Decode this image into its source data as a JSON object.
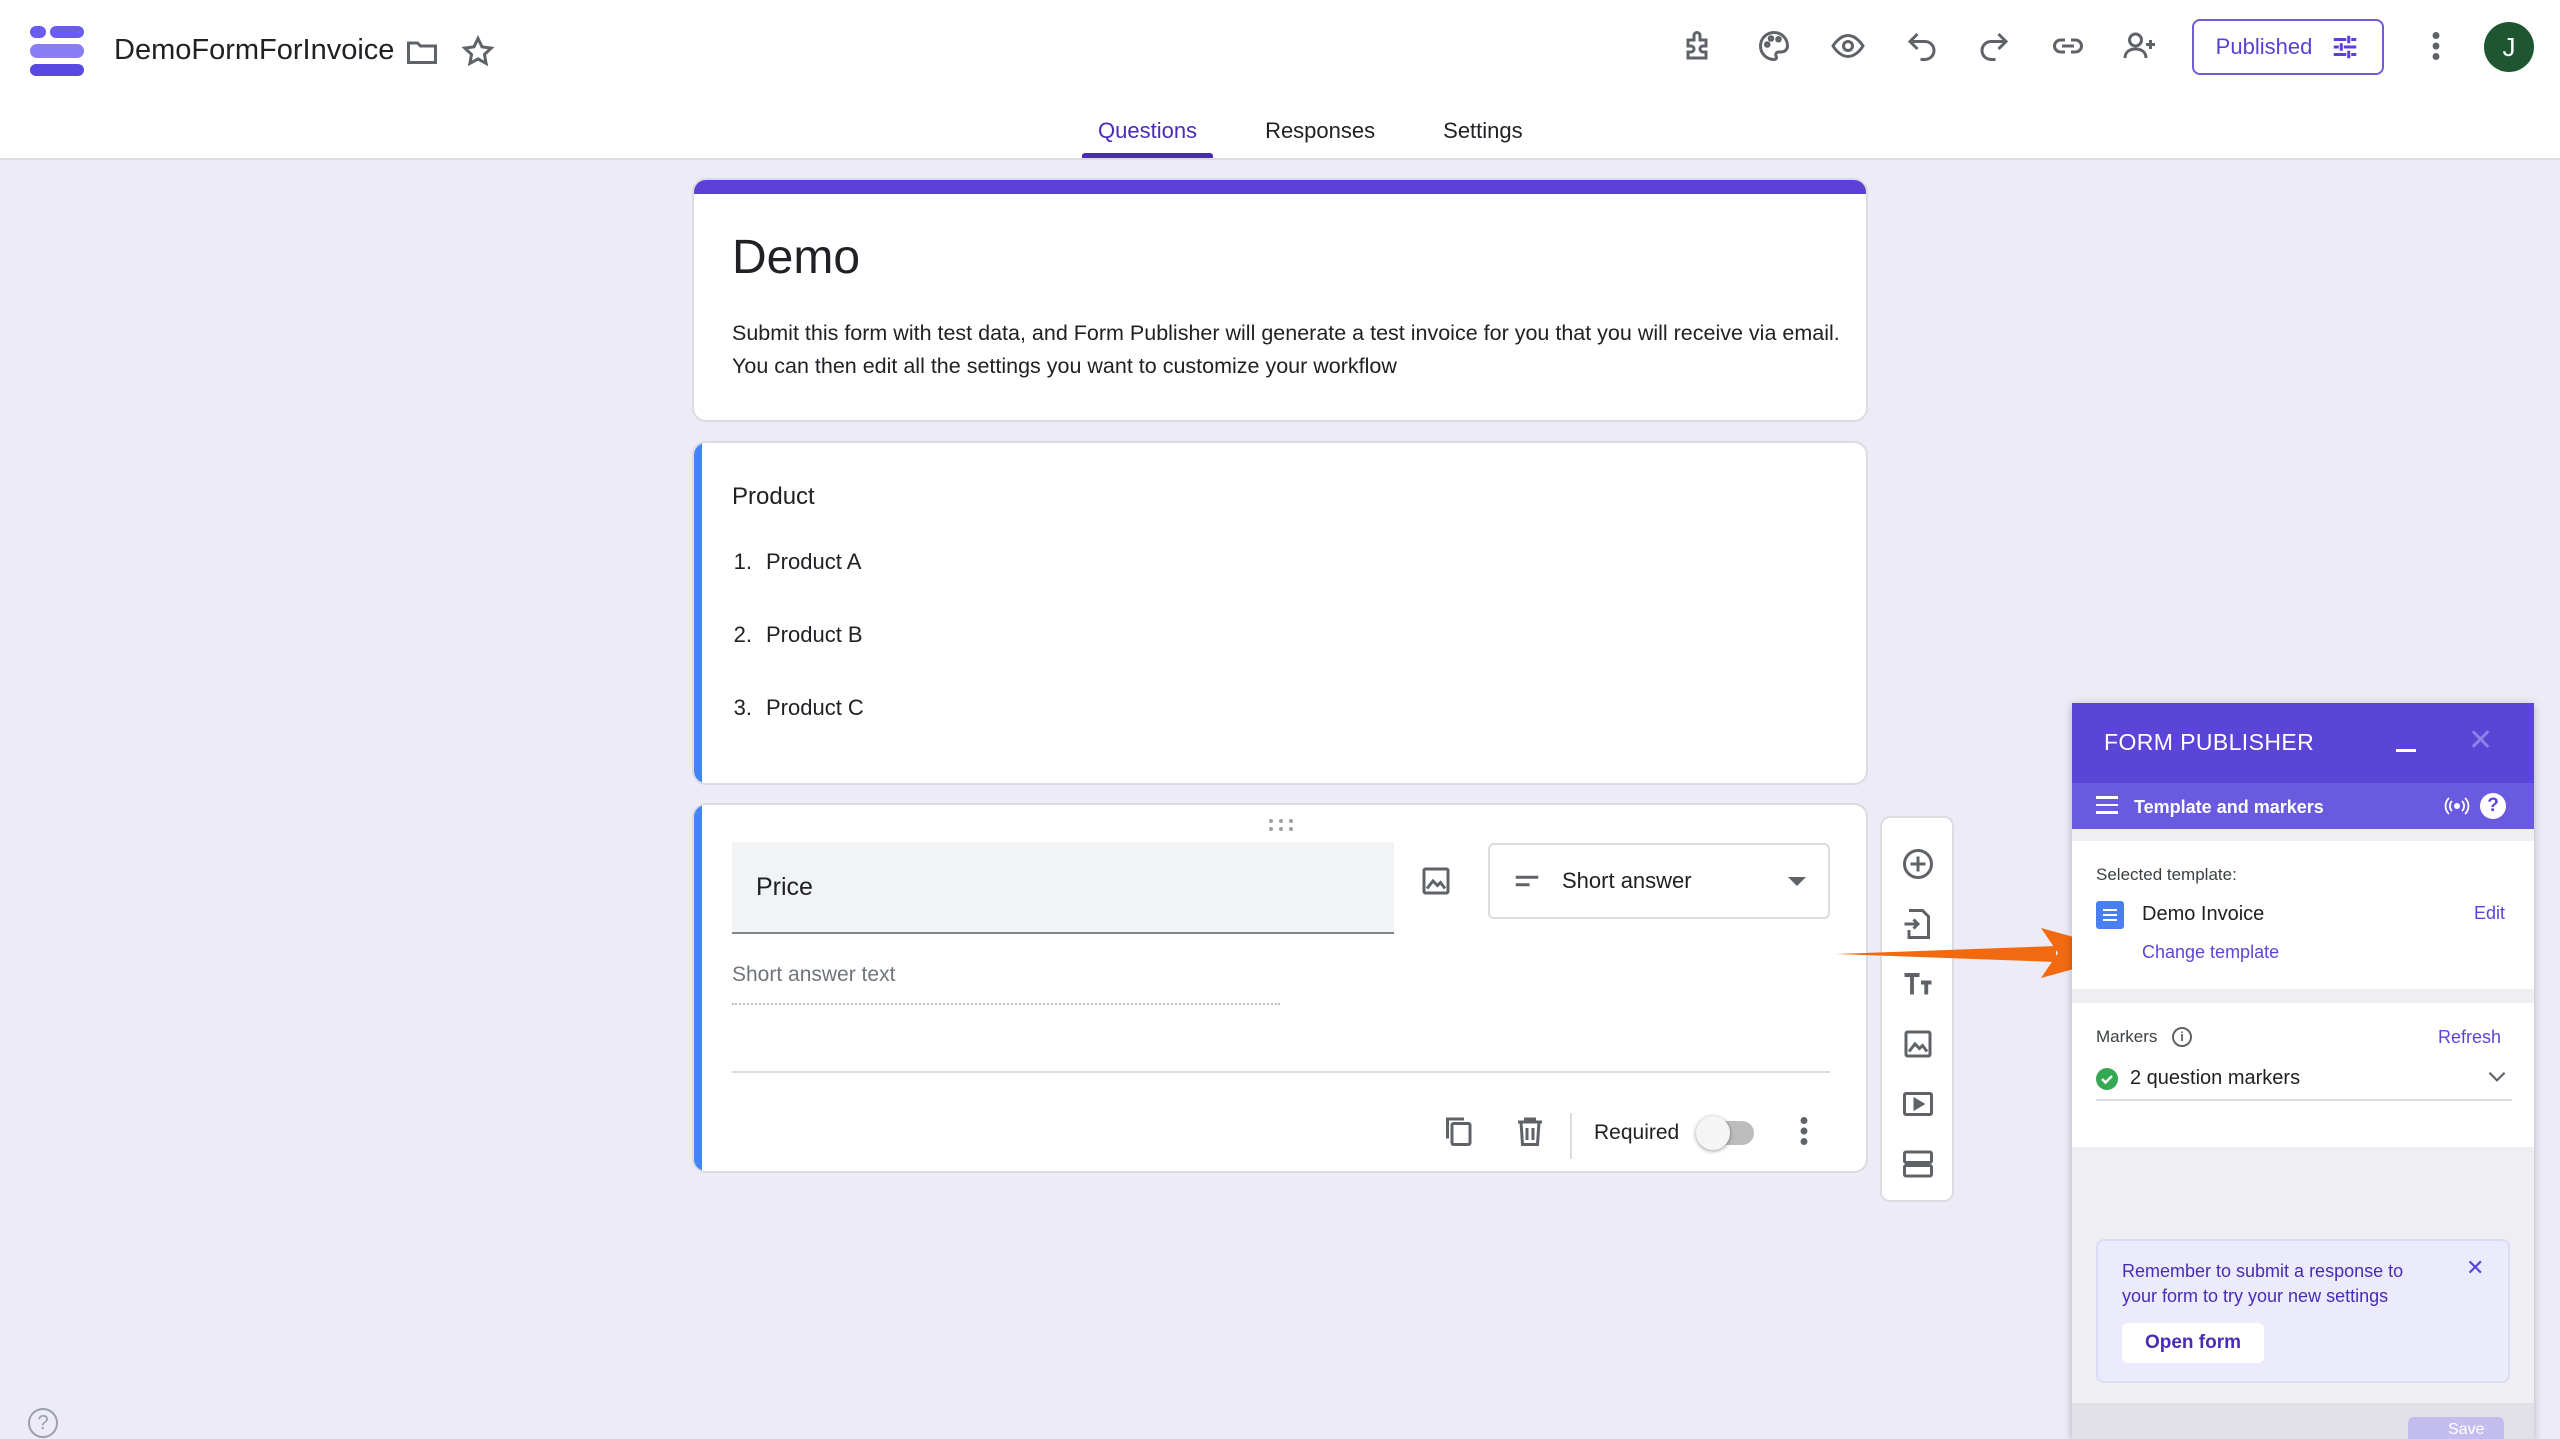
{
  "app": {
    "doc_title": "DemoFormForInvoice",
    "published_label": "Published",
    "avatar_initial": "J"
  },
  "tabs": [
    {
      "label": "Questions",
      "active": true
    },
    {
      "label": "Responses",
      "active": false
    },
    {
      "label": "Settings",
      "active": false
    }
  ],
  "form": {
    "title": "Demo",
    "description": "Submit this form with test data, and Form Publisher will generate a test invoice for you that you will receive via email. You can then edit all the settings you want to customize your workflow"
  },
  "product_section": {
    "title": "Product",
    "items": [
      {
        "num": "1.",
        "label": "Product A"
      },
      {
        "num": "2.",
        "label": "Product B"
      },
      {
        "num": "3.",
        "label": "Product C"
      }
    ]
  },
  "question": {
    "title": "Price",
    "type": "Short answer",
    "answer_placeholder": "Short answer text",
    "required_label": "Required",
    "required": false
  },
  "form_publisher": {
    "header": "FORM PUBLISHER",
    "section_title": "Template and markers",
    "selected_template_label": "Selected template:",
    "template_name": "Demo Invoice",
    "edit_label": "Edit",
    "change_template_label": "Change template",
    "markers_label": "Markers",
    "refresh_label": "Refresh",
    "markers_summary": "2 question markers",
    "tip_text": "Remember to submit a response to your form to try your new settings",
    "open_form_label": "Open form",
    "save_label": "Save"
  },
  "colors": {
    "accent": "#5b3fd6",
    "question_accent": "#4285f4",
    "arrow": "#f26a10",
    "avatar": "#1e5631"
  }
}
